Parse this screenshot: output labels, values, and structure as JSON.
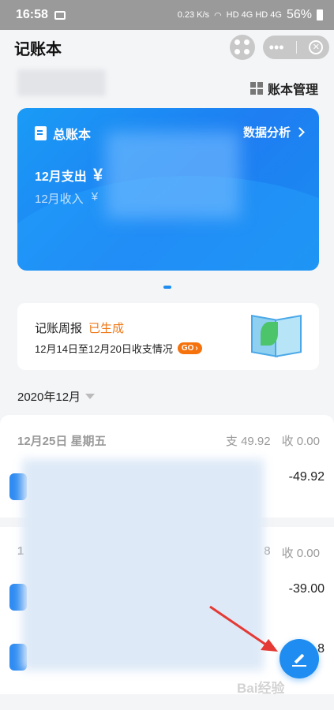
{
  "status_bar": {
    "time": "16:58",
    "speed": "0.23 K/s",
    "network": "HD 4G HD 4G",
    "battery": "56%"
  },
  "nav": {
    "title": "记账本"
  },
  "header": {
    "book_manage": "账本管理"
  },
  "card": {
    "title": "总账本",
    "analysis_link": "数据分析",
    "expense_label": "12月支出",
    "expense_symbol": "¥",
    "income_label": "12月收入",
    "income_symbol": "¥"
  },
  "weekly": {
    "title": "记账周报",
    "status": "已生成",
    "subtitle": "12月14日至12月20日收支情况",
    "go_label": "GO"
  },
  "month_selector": {
    "label": "2020年12月"
  },
  "days": [
    {
      "date": "12月25日 星期五",
      "expense": "支 49.92",
      "income": "收 0.00",
      "entries": [
        "-49.92"
      ]
    },
    {
      "date": "1",
      "expense": "8",
      "income": "收 0.00",
      "entries": [
        "-39.00",
        "8"
      ]
    }
  ],
  "watermark": "Bai经验",
  "colors": {
    "accent": "#1e8cf0",
    "status_orange": "#f07a1a",
    "annotation_red": "#e53935"
  }
}
